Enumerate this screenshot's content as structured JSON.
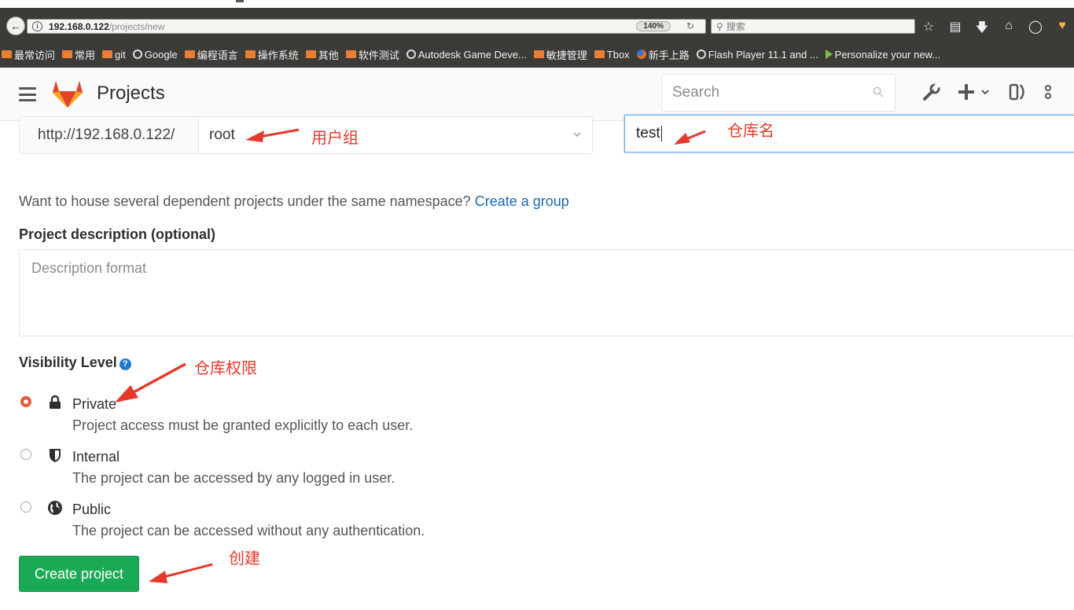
{
  "browser": {
    "url_host": "192.168.0.122",
    "url_path": "/projects/new",
    "zoom": "140%",
    "search_placeholder": "搜索",
    "bookmarks": [
      {
        "label": "最常访问",
        "icon": "folder"
      },
      {
        "label": "常用",
        "icon": "folder"
      },
      {
        "label": "git",
        "icon": "folder"
      },
      {
        "label": "Google",
        "icon": "globe"
      },
      {
        "label": "编程语言",
        "icon": "folder"
      },
      {
        "label": "操作系统",
        "icon": "folder"
      },
      {
        "label": "其他",
        "icon": "folder"
      },
      {
        "label": "软件测试",
        "icon": "folder"
      },
      {
        "label": "Autodesk Game Deve...",
        "icon": "globe"
      },
      {
        "label": "敏捷管理",
        "icon": "folder"
      },
      {
        "label": "Tbox",
        "icon": "folder"
      },
      {
        "label": "新手上路",
        "icon": "firefox"
      },
      {
        "label": "Flash Player 11.1 and ...",
        "icon": "globe"
      },
      {
        "label": "Personalize your new...",
        "icon": "play"
      }
    ]
  },
  "header": {
    "title": "Projects",
    "search_placeholder": "Search"
  },
  "form": {
    "namespace_prefix": "http://192.168.0.122/",
    "namespace_value": "root",
    "project_name": "test",
    "group_hint": "Want to house several dependent projects under the same namespace?",
    "group_link": "Create a group",
    "description_label": "Project description (optional)",
    "description_placeholder": "Description format",
    "visibility_label": "Visibility Level",
    "visibility_options": [
      {
        "title": "Private",
        "desc": "Project access must be granted explicitly to each user.",
        "icon": "lock-icon",
        "checked": true
      },
      {
        "title": "Internal",
        "desc": "The project can be accessed by any logged in user.",
        "icon": "shield-icon",
        "checked": false
      },
      {
        "title": "Public",
        "desc": "The project can be accessed without any authentication.",
        "icon": "globe-icon",
        "checked": false
      }
    ],
    "create_button": "Create project"
  },
  "annotations": {
    "user_group": "用户组",
    "repo_name": "仓库名",
    "repo_permission": "仓库权限",
    "create": "创建",
    "color": "#e8372b"
  },
  "colors": {
    "accent_blue": "#1b69b6",
    "create_green": "#1aaa55",
    "radio_checked": "#e85c3a",
    "browser_chrome": "#3c3b37"
  }
}
